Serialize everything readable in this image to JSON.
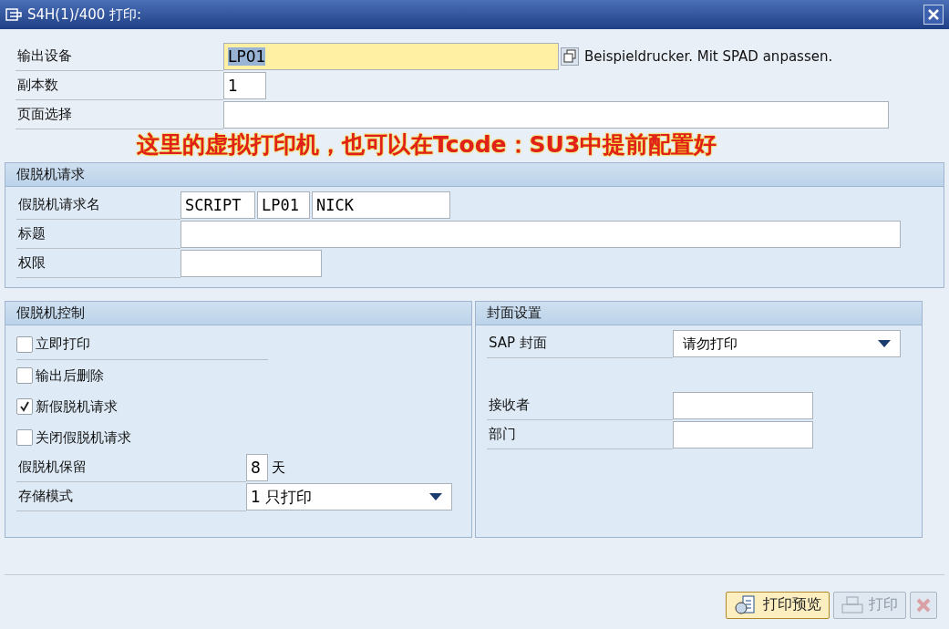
{
  "window": {
    "title": "S4H(1)/400 打印:"
  },
  "output": {
    "fields": [
      {
        "label": "输出设备",
        "value": "LP01",
        "kind": "device",
        "note": "Beispieldrucker. Mit SPAD anpassen."
      },
      {
        "label": "副本数",
        "value": "1",
        "kind": "short"
      },
      {
        "label": "页面选择",
        "kind": "wide"
      }
    ]
  },
  "annotation": "这里的虚拟打印机，也可以在Tcode：SU3中提前配置好",
  "spool_request": {
    "title": "假脱机请求",
    "name_label": "假脱机请求名",
    "name_parts": [
      "SCRIPT",
      "LP01",
      "NICK"
    ],
    "fields": [
      {
        "label": "标题",
        "kind": "wide"
      },
      {
        "label": "权限",
        "kind": "short"
      }
    ]
  },
  "spool_control": {
    "title": "假脱机控制",
    "checkboxes": [
      {
        "label": "立即打印",
        "checked": false
      },
      {
        "label": "输出后删除",
        "checked": false
      },
      {
        "label": "新假脱机请求",
        "checked": true
      },
      {
        "label": "关闭假脱机请求",
        "checked": false
      }
    ],
    "retention": {
      "label": "假脱机保留",
      "value": "8",
      "unit": "天"
    },
    "storage": {
      "label": "存储模式",
      "value": "1 只打印"
    }
  },
  "cover": {
    "title": "封面设置",
    "sap_cover": {
      "label": "SAP 封面",
      "value": "请勿打印"
    },
    "fields": [
      {
        "label": "接收者"
      },
      {
        "label": "部门"
      }
    ]
  },
  "buttons": [
    {
      "label": "打印预览",
      "kind": "preview"
    },
    {
      "label": "打印",
      "kind": "print"
    },
    {
      "kind": "cancel"
    }
  ]
}
